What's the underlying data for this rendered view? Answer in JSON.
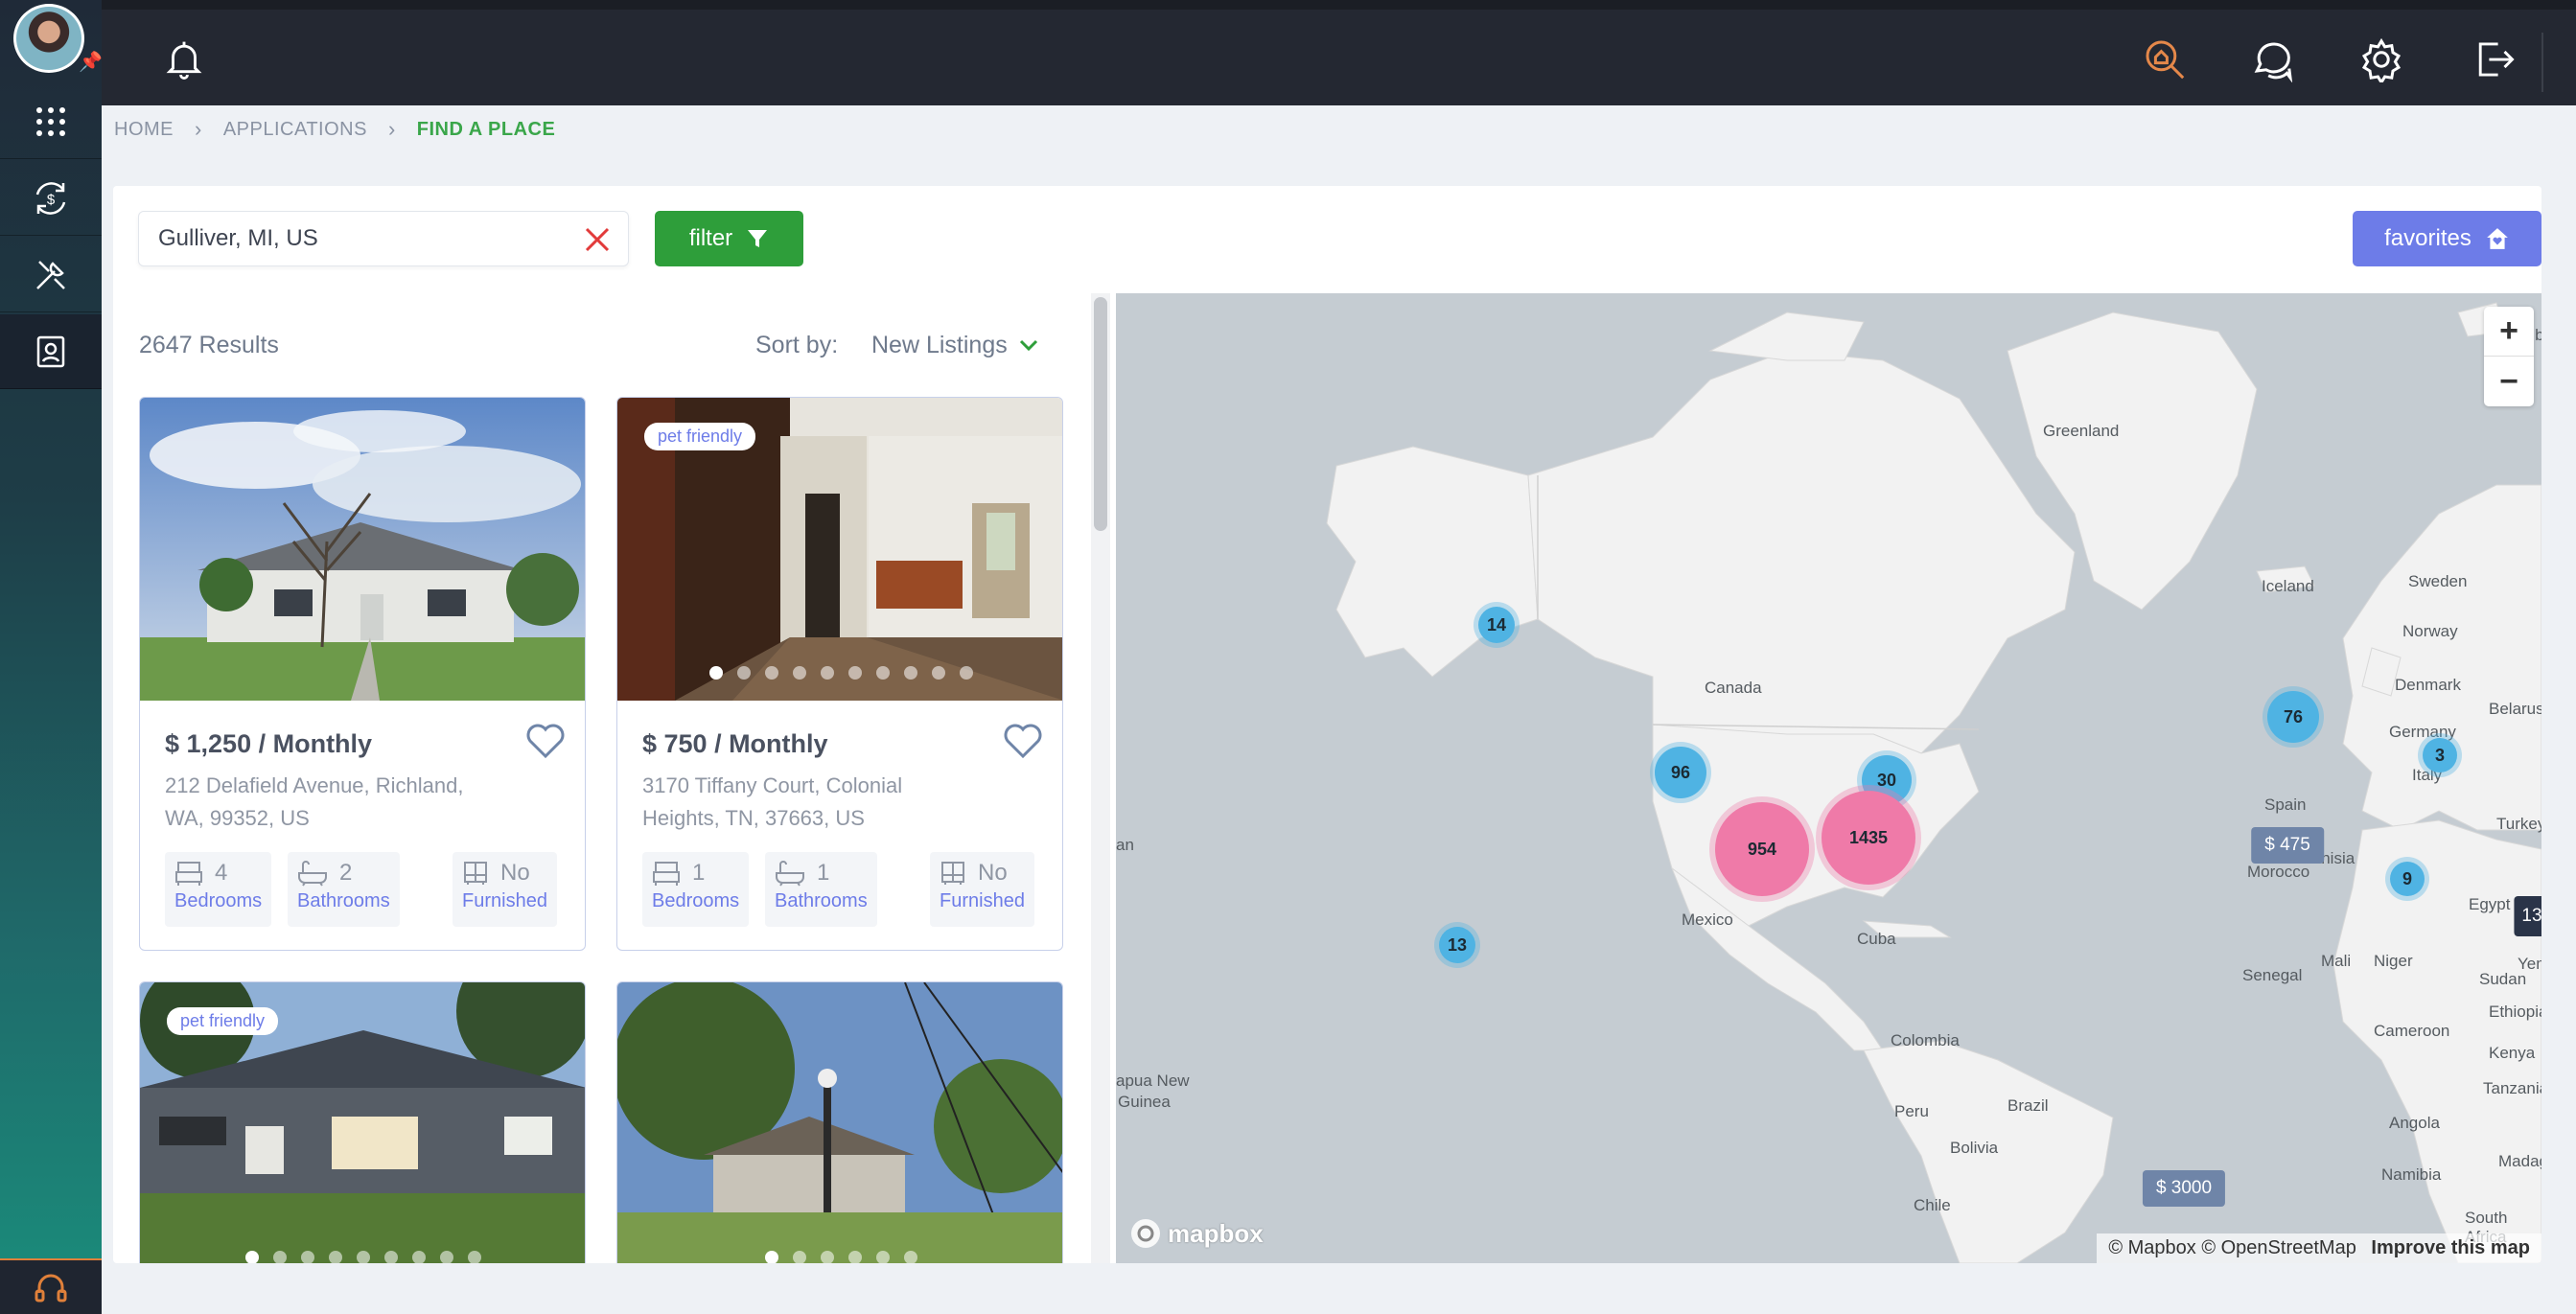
{
  "breadcrumb": {
    "home": "HOME",
    "applications": "APPLICATIONS",
    "current": "FIND A PLACE"
  },
  "search": {
    "value": "Gulliver, MI, US"
  },
  "filter_label": "filter",
  "favorites_label": "favorites",
  "results_count": "2647 Results",
  "sort": {
    "label": "Sort by:",
    "value": "New Listings"
  },
  "listings": [
    {
      "badge": "",
      "price": "$ 1,250 / Monthly",
      "address": "212 Delafield Avenue, Richland, WA, 99352, US",
      "bedrooms": "4",
      "bathrooms": "2",
      "furnished": "No",
      "dots": 0,
      "active_dot": 0
    },
    {
      "badge": "pet friendly",
      "price": "$ 750 / Monthly",
      "address": "3170 Tiffany Court, Colonial Heights, TN, 37663, US",
      "bedrooms": "1",
      "bathrooms": "1",
      "furnished": "No",
      "dots": 10,
      "active_dot": 0
    },
    {
      "badge": "pet friendly",
      "dots": 9,
      "active_dot": 0
    },
    {
      "badge": "",
      "dots": 6,
      "active_dot": 0
    }
  ],
  "feature_labels": {
    "bedrooms": "Bedrooms",
    "bathrooms": "Bathrooms",
    "furnished": "Furnished"
  },
  "map": {
    "labels": [
      "Svalbard",
      "Greenland",
      "Iceland",
      "Sweden",
      "Norway",
      "Denmark",
      "Belarus",
      "Germany",
      "Canada",
      "Italy",
      "Turkey",
      "Spain",
      "Tunisia",
      "Morocco",
      "Egypt",
      "Mexico",
      "Cuba",
      "Mali",
      "Niger",
      "Sudan",
      "Senegal",
      "Ethiopia",
      "Cameroon",
      "Kenya",
      "Colombia",
      "Tanzania",
      "Brazil",
      "Peru",
      "Angola",
      "Bolivia",
      "Namibia",
      "Chile",
      "Madag",
      "South Africa",
      "Yem",
      "an",
      "apua New",
      "Guinea"
    ],
    "clusters": [
      {
        "count": "14",
        "color": "blue"
      },
      {
        "count": "96",
        "color": "blue"
      },
      {
        "count": "30",
        "color": "blue"
      },
      {
        "count": "954",
        "color": "pink"
      },
      {
        "count": "1435",
        "color": "pink"
      },
      {
        "count": "13",
        "color": "blue"
      },
      {
        "count": "76",
        "color": "blue"
      },
      {
        "count": "3",
        "color": "blue"
      },
      {
        "count": "9",
        "color": "blue"
      }
    ],
    "price_tags": [
      "$ 475",
      "$ 3000"
    ],
    "edge_tag": "13",
    "attribution": "© Mapbox © OpenStreetMap",
    "improve": "Improve this map",
    "logo": "mapbox",
    "zoom_in": "+",
    "zoom_out": "−"
  },
  "colors": {
    "accent_green": "#2e9e3a",
    "accent_purple": "#6d7ce8",
    "cluster_blue": "#4fb3e3",
    "cluster_pink": "#ef7aa8"
  }
}
